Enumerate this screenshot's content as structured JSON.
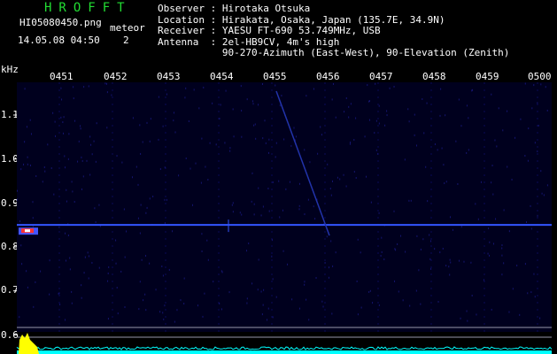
{
  "logo": "HROFFT",
  "file_name": "HI05080450.png",
  "meteor": {
    "label": "meteor",
    "count": "2"
  },
  "datetime": "14.05.08 04:50",
  "info": {
    "observer_label": "Observer",
    "observer": "Hirotaka Otsuka",
    "location_label": "Location",
    "location": "Hirakata, Osaka, Japan (135.7E, 34.9N)",
    "receiver_label": "Receiver",
    "receiver": "YAESU FT-690 53.749MHz, USB",
    "antenna_label": "Antenna",
    "antenna": "2el-HB9CV, 4m's high",
    "antenna_line2": "90-270-Azimuth (East-West), 90-Elevation (Zenith)"
  },
  "chart_data": {
    "type": "heatmap",
    "ylabel": "kHz",
    "x_ticks": [
      "0451",
      "0452",
      "0453",
      "0454",
      "0455",
      "0456",
      "0457",
      "0458",
      "0459",
      "0500"
    ],
    "y_ticks": [
      "1.1",
      "1.0",
      "0.9",
      "0.8",
      "0.7",
      "0.6"
    ],
    "ylim": [
      0.58,
      1.15
    ],
    "carrier_khz": 0.85,
    "colors": {
      "background": "#00001e",
      "carrier": "#3355ff",
      "meteor": "#ff3333",
      "level": "#00ffff",
      "peak": "#ffff00",
      "text": "#22dd33"
    }
  }
}
